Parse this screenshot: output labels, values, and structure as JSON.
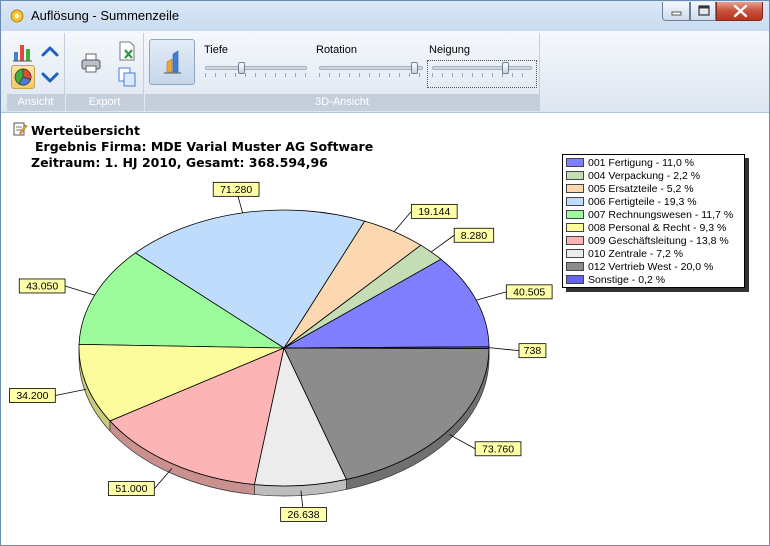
{
  "window": {
    "title": "Auflösung - Summenzeile"
  },
  "ribbon": {
    "groups": [
      {
        "label": "Ansicht"
      },
      {
        "label": "Export"
      },
      {
        "label": "3D-Ansicht"
      }
    ],
    "sliders": [
      {
        "label": "Tiefe",
        "level": 0.35
      },
      {
        "label": "Rotation",
        "level": 0.95
      },
      {
        "label": "Neigung",
        "level": 0.75
      }
    ],
    "icons": {
      "bar_chart": "bar-chart-icon",
      "pie_chart": "pie-chart-icon",
      "up": "chevron-up-icon",
      "down": "chevron-down-icon",
      "print": "printer-icon",
      "excel": "excel-export-icon",
      "copy": "copy-icon",
      "view3d": "3d-chart-icon"
    }
  },
  "content": {
    "heading": "Werteübersicht",
    "firm_line": "Ergebnis Firma: MDE Varial  Muster AG Software",
    "period_line": "Zeitraum: 1. HJ 2010, Gesamt: 368.594,96"
  },
  "legend": [
    {
      "text": "001 Fertigung - 11,0 %",
      "color": "#7f7fff"
    },
    {
      "text": "004 Verpackung - 2,2 %",
      "color": "#c4ddb5"
    },
    {
      "text": "005 Ersatzteile - 5,2 %",
      "color": "#fbd8b0"
    },
    {
      "text": "006 Fertigteile - 19,3 %",
      "color": "#bfdcfc"
    },
    {
      "text": "007 Rechnungswesen - 11,7 %",
      "color": "#9cfc9c"
    },
    {
      "text": "008 Personal & Recht - 9,3 %",
      "color": "#fcfc9c"
    },
    {
      "text": "009 Geschäftsleitung - 13,8 %",
      "color": "#fcb4b4"
    },
    {
      "text": "010 Zentrale - 7,2 %",
      "color": "#ececec"
    },
    {
      "text": "012 Vertrieb West - 20,0 %",
      "color": "#8c8c8c"
    },
    {
      "text": "Sonstige - 0,2 %",
      "color": "#6464ec"
    }
  ],
  "chart_data": {
    "type": "pie",
    "title": "",
    "categories": [
      "001 Fertigung",
      "004 Verpackung",
      "005 Ersatzteile",
      "006 Fertigteile",
      "007 Rechnungswesen",
      "008 Personal & Recht",
      "009 Geschäftsleitung",
      "010 Zentrale",
      "012 Vertrieb West",
      "Sonstige"
    ],
    "values": [
      40505,
      8280,
      19144,
      71280,
      43050,
      34200,
      51000,
      26638,
      73760,
      738
    ],
    "value_labels": [
      "40.505",
      "8.280",
      "19.144",
      "71.280",
      "43.050",
      "34.200",
      "51.000",
      "26.638",
      "73.760",
      "738"
    ],
    "colors": [
      "#7f7fff",
      "#c4ddb5",
      "#fbd8b0",
      "#bfdcfc",
      "#9cfc9c",
      "#fcfc9c",
      "#fcb4b4",
      "#ececec",
      "#8c8c8c",
      "#6464ec"
    ],
    "legend_position": "right",
    "style": "3d-pie"
  }
}
